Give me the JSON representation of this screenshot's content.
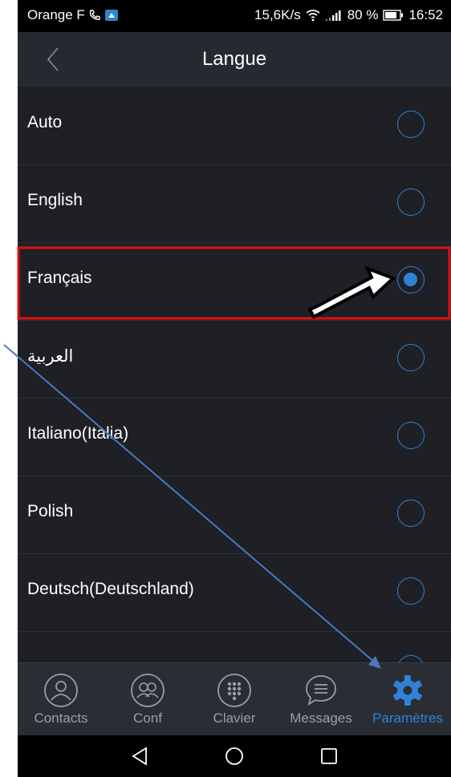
{
  "status_bar": {
    "carrier": "Orange F",
    "network_speed": "15,6K/s",
    "battery": "80 %",
    "time": "16:52"
  },
  "header": {
    "title": "Langue"
  },
  "languages": [
    {
      "label": "Auto",
      "selected": false
    },
    {
      "label": "English",
      "selected": false
    },
    {
      "label": "Français",
      "selected": true
    },
    {
      "label": "العربية",
      "selected": false
    },
    {
      "label": "Italiano(Italia)",
      "selected": false
    },
    {
      "label": "Polish",
      "selected": false
    },
    {
      "label": "Deutsch(Deutschland)",
      "selected": false
    },
    {
      "label": "",
      "selected": false
    }
  ],
  "tabs": [
    {
      "label": "Contacts",
      "icon": "contacts-icon",
      "active": false
    },
    {
      "label": "Conf",
      "icon": "conference-icon",
      "active": false
    },
    {
      "label": "Clavier",
      "icon": "dialpad-icon",
      "active": false
    },
    {
      "label": "Messages",
      "icon": "messages-icon",
      "active": false
    },
    {
      "label": "Paramètres",
      "icon": "gear-icon",
      "active": true
    }
  ],
  "colors": {
    "accent": "#2f82d6",
    "background": "#1e2026",
    "highlight_box": "#e01010",
    "annotation_line": "#4a78bf"
  }
}
